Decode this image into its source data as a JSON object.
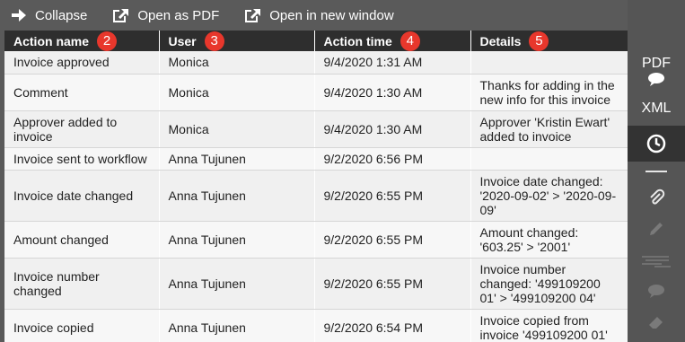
{
  "toolbar": {
    "collapse_label": "Collapse",
    "open_pdf_label": "Open as PDF",
    "open_window_label": "Open in new window"
  },
  "table": {
    "headers": [
      {
        "label": "Action name",
        "badge": "2"
      },
      {
        "label": "User",
        "badge": "3"
      },
      {
        "label": "Action time",
        "badge": "4"
      },
      {
        "label": "Details",
        "badge": "5"
      }
    ],
    "rows": [
      {
        "action": "Invoice approved",
        "user": "Monica",
        "time": "9/4/2020 1:31 AM",
        "details": ""
      },
      {
        "action": "Comment",
        "user": "Monica",
        "time": "9/4/2020 1:30 AM",
        "details": "Thanks for adding in the new info for this invoice"
      },
      {
        "action": "Approver added to invoice",
        "user": "Monica",
        "time": "9/4/2020 1:30 AM",
        "details": "Approver 'Kristin Ewart' added to invoice"
      },
      {
        "action": "Invoice sent to workflow",
        "user": "Anna Tujunen",
        "time": "9/2/2020 6:56 PM",
        "details": ""
      },
      {
        "action": "Invoice date changed",
        "user": "Anna Tujunen",
        "time": "9/2/2020 6:55 PM",
        "details": "Invoice date changed: '2020-09-02' > '2020-09-09'"
      },
      {
        "action": "Amount changed",
        "user": "Anna Tujunen",
        "time": "9/2/2020 6:55 PM",
        "details": "Amount changed: '603.25' > '2001'"
      },
      {
        "action": "Invoice number changed",
        "user": "Anna Tujunen",
        "time": "9/2/2020 6:55 PM",
        "details": "Invoice number changed: '499109200 01' > '499109200 04'"
      },
      {
        "action": "Invoice copied",
        "user": "Anna Tujunen",
        "time": "9/2/2020 6:54 PM",
        "details": "Invoice copied from invoice '499109200 01'"
      }
    ]
  },
  "sidebar": {
    "pdf_label": "PDF",
    "xml_label": "XML",
    "icons": [
      "comment-icon",
      "history-clock-icon",
      "paperclip-icon",
      "pencil-icon",
      "barcode-icon",
      "chat-icon",
      "eraser-icon"
    ]
  },
  "colors": {
    "badge": "#e8372c",
    "header_bg": "#2e2e2e",
    "toolbar_bg": "#5a5a5a",
    "sidebar_active": "#333333"
  }
}
